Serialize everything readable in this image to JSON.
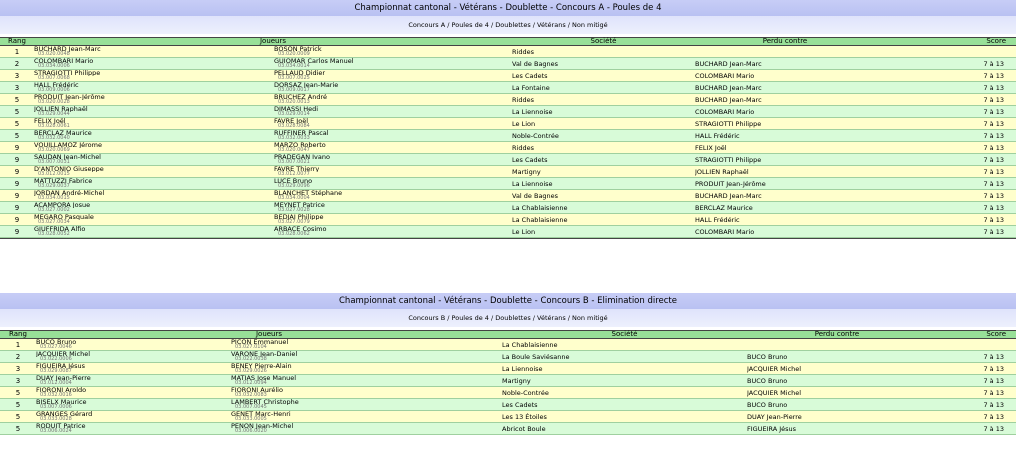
{
  "contests": [
    {
      "title": "Championnat cantonal - Vétérans - Doublette - Concours A - Poules de 4",
      "breadcrumb": "Concours A / Poules de 4 / Doublettes / Vétérans / Non mitigé",
      "headers": {
        "rank": "Rang",
        "players": "Joueurs",
        "society": "Société",
        "lost_to": "Perdu contre",
        "score": "Score"
      },
      "rows": [
        {
          "rank": "1",
          "p1": "BUCHARD Jean-Marc",
          "l1": "03.020.0048",
          "p2": "BOSON Patrick",
          "l2": "03.020.0009",
          "society": "Riddes",
          "lost_to": "",
          "score": ""
        },
        {
          "rank": "2",
          "p1": "COLOMBARI Mario",
          "l1": "03.034.0006",
          "p2": "GUIOMAR Carlos Manuel",
          "l2": "03.034.0014",
          "society": "Val de Bagnes",
          "lost_to": "BUCHARD Jean-Marc",
          "score": "7 à 13"
        },
        {
          "rank": "3",
          "p1": "STRAGIOTTI Philippe",
          "l1": "03.007.0068",
          "p2": "PELLAUD Didier",
          "l2": "03.007.0025",
          "society": "Les Cadets",
          "lost_to": "COLOMBARI Mario",
          "score": "7 à 13"
        },
        {
          "rank": "3",
          "p1": "HALL Frédéric",
          "l1": "03.009.0006",
          "p2": "DORSAZ Jean-Marie",
          "l2": "03.009.0017",
          "society": "La Fontaine",
          "lost_to": "BUCHARD Jean-Marc",
          "score": "7 à 13"
        },
        {
          "rank": "5",
          "p1": "PRODUIT Jean-Jérôme",
          "l1": "03.020.0028",
          "p2": "BRUCHEZ André",
          "l2": "03.020.0013",
          "society": "Riddes",
          "lost_to": "BUCHARD Jean-Marc",
          "score": "7 à 13"
        },
        {
          "rank": "5",
          "p1": "JOLLIEN Raphaël",
          "l1": "03.029.0044",
          "p2": "DIMASSI Hedi",
          "l2": "03.029.0014",
          "society": "La Liennoise",
          "lost_to": "COLOMBARI Mario",
          "score": "7 à 13"
        },
        {
          "rank": "5",
          "p1": "FELIX Joël",
          "l1": "03.028.0061",
          "p2": "FAVRE Joël",
          "l2": "03.028.0084",
          "society": "Le Lion",
          "lost_to": "STRAGIOTTI Philippe",
          "score": "7 à 13"
        },
        {
          "rank": "5",
          "p1": "BERCLAZ Maurice",
          "l1": "03.032.0040",
          "p2": "RUFFINER Pascal",
          "l2": "03.032.0033",
          "society": "Noble-Contrée",
          "lost_to": "HALL Frédéric",
          "score": "7 à 13"
        },
        {
          "rank": "9",
          "p1": "VOUILLAMOZ Jérome",
          "l1": "03.020.0069",
          "p2": "MARZO Roberto",
          "l2": "03.020.0047",
          "society": "Riddes",
          "lost_to": "FELIX Joël",
          "score": "7 à 13"
        },
        {
          "rank": "9",
          "p1": "SAUDAN Jean-Michel",
          "l1": "03.007.0031",
          "p2": "PRADEGAN Ivano",
          "l2": "03.007.0021",
          "society": "Les Cadets",
          "lost_to": "STRAGIOTTI Philippe",
          "score": "7 à 13"
        },
        {
          "rank": "9",
          "p1": "D'ANTONIO Giuseppe",
          "l1": "03.012.0015",
          "p2": "FAVRE Thierry",
          "l2": "03.012.0077",
          "society": "Martigny",
          "lost_to": "JOLLIEN Raphaël",
          "score": "7 à 13"
        },
        {
          "rank": "9",
          "p1": "MATTUZZI Fabrice",
          "l1": "03.029.0037",
          "p2": "LUCE Bruno",
          "l2": "03.029.0096",
          "society": "La Liennoise",
          "lost_to": "PRODUIT Jean-Jérôme",
          "score": "7 à 13"
        },
        {
          "rank": "9",
          "p1": "JORDAN André-Michel",
          "l1": "03.034.0015",
          "p2": "BLANCHET Stéphane",
          "l2": "03.034.0004",
          "society": "Val de Bagnes",
          "lost_to": "BUCHARD Jean-Marc",
          "score": "7 à 13"
        },
        {
          "rank": "9",
          "p1": "ACAMPORA Josue",
          "l1": "03.027.0002",
          "p2": "MEYNET Patrice",
          "l2": "03.027.0028",
          "society": "La Chablaisienne",
          "lost_to": "BERCLAZ Maurice",
          "score": "7 à 13"
        },
        {
          "rank": "9",
          "p1": "MEGARO Pasquale",
          "l1": "03.027.0034",
          "p2": "BEDJAI Philippe",
          "l2": "03.027.0079",
          "society": "La Chablaisienne",
          "lost_to": "HALL Frédéric",
          "score": "7 à 13"
        },
        {
          "rank": "9",
          "p1": "GIUFFRIDA Alfio",
          "l1": "03.028.0052",
          "p2": "ARBACE Cosimo",
          "l2": "03.028.0062",
          "society": "Le Lion",
          "lost_to": "COLOMBARI Mario",
          "score": "7 à 13"
        }
      ]
    },
    {
      "title": "Championnat cantonal - Vétérans - Doublette - Concours B - Elimination directe",
      "breadcrumb": "Concours B / Poules de 4 / Doublettes / Vétérans / Non mitigé",
      "headers": {
        "rank": "Rang",
        "players": "Joueurs",
        "society": "Société",
        "lost_to": "Perdu contre",
        "score": "Score"
      },
      "rows": [
        {
          "rank": "1",
          "p1": "BUCO Bruno",
          "l1": "03.027.0046",
          "p2": "PICON Emmanuel",
          "l2": "03.027.0104",
          "society": "La Chablaisienne",
          "lost_to": "",
          "score": ""
        },
        {
          "rank": "2",
          "p1": "JACQUIER Michel",
          "l1": "03.022.0006",
          "p2": "VARONE Jean-Daniel",
          "l2": "03.022.0038",
          "society": "La Boule Saviésanne",
          "lost_to": "BUCO Bruno",
          "score": "7 à 13"
        },
        {
          "rank": "3",
          "p1": "FIGUEIRA Jésus",
          "l1": "03.029.0087",
          "p2": "BENEY Pierre-Alain",
          "l2": "03.029.0026",
          "society": "La Liennoise",
          "lost_to": "JACQUIER Michel",
          "score": "7 à 13"
        },
        {
          "rank": "3",
          "p1": "DUAY Jean-Pierre",
          "l1": "03.012.0004",
          "p2": "MATIAS Jose Manuel",
          "l2": "03.012.0094",
          "society": "Martigny",
          "lost_to": "BUCO Bruno",
          "score": "7 à 13"
        },
        {
          "rank": "5",
          "p1": "FIORONI Aroldo",
          "l1": "03.032.0016",
          "p2": "FIORONI Aurélio",
          "l2": "03.032.0083",
          "society": "Noble-Contrée",
          "lost_to": "JACQUIER Michel",
          "score": "7 à 13"
        },
        {
          "rank": "5",
          "p1": "BISELX Maurice",
          "l1": "03.007.0006",
          "p2": "LAMBERT Christophe",
          "l2": "03.007.0045",
          "society": "Les Cadets",
          "lost_to": "BUCO Bruno",
          "score": "7 à 13"
        },
        {
          "rank": "5",
          "p1": "GRANGES Gérard",
          "l1": "03.033.0028",
          "p2": "GENET Marc-Henri",
          "l2": "03.033.0005",
          "society": "Les 13 Étoiles",
          "lost_to": "DUAY Jean-Pierre",
          "score": "7 à 13"
        },
        {
          "rank": "5",
          "p1": "RODUIT Patrice",
          "l1": "03.006.0024",
          "p2": "PENON Jean-Michel",
          "l2": "03.006.0020",
          "society": "Abricot Boule",
          "lost_to": "FIGUEIRA Jésus",
          "score": "7 à 13"
        }
      ]
    }
  ]
}
